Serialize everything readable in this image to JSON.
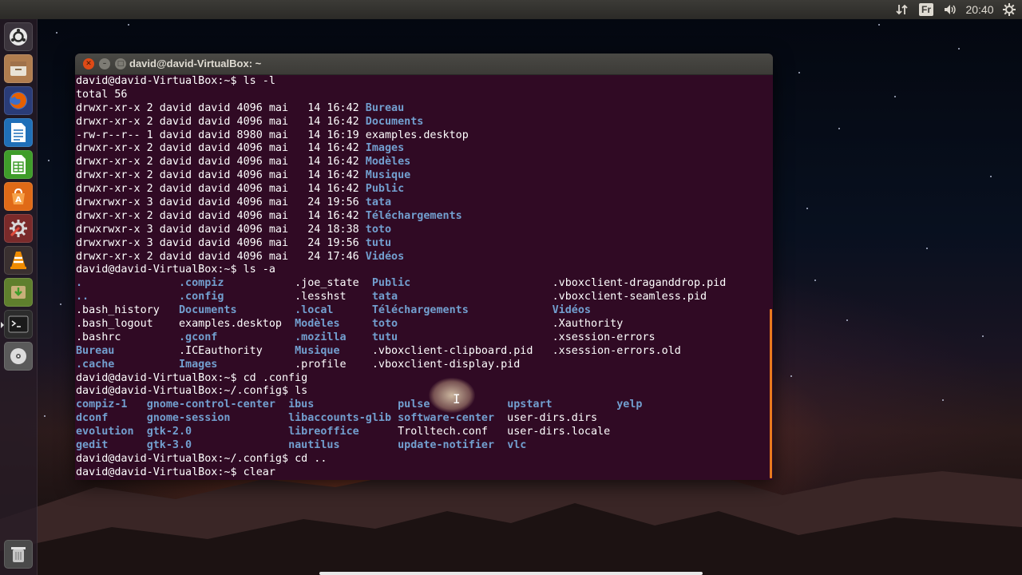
{
  "top_panel": {
    "keyboard_layout": "Fr",
    "clock": "20:40",
    "icons": [
      "network-arrows-icon",
      "keyboard-layout-icon",
      "volume-icon",
      "gear-icon"
    ]
  },
  "launcher": {
    "items": [
      {
        "name": "ubuntu-dash-icon",
        "color": "#1c5aa8"
      },
      {
        "name": "files-icon",
        "color": "#8a6d4a"
      },
      {
        "name": "firefox-icon",
        "color": "#e66000"
      },
      {
        "name": "libreoffice-writer-icon",
        "color": "#1f6fb8"
      },
      {
        "name": "libreoffice-calc-icon",
        "color": "#3f9d2a"
      },
      {
        "name": "software-center-icon",
        "color": "#e06a17"
      },
      {
        "name": "system-settings-icon",
        "color": "#b8403a"
      },
      {
        "name": "vlc-icon",
        "color": "#f08c00"
      },
      {
        "name": "archive-installer-icon",
        "color": "#7fb03d"
      },
      {
        "name": "terminal-icon",
        "color": "#3a3a3a"
      },
      {
        "name": "dvd-icon",
        "color": "#c8c8c8"
      },
      {
        "name": "trash-icon",
        "color": "#8a8a8a"
      }
    ]
  },
  "window": {
    "title": "david@david-VirtualBox: ~",
    "background": "#300a24",
    "dir_color": "#729fcf",
    "lines": [
      [
        {
          "t": "david@david-VirtualBox:~$ ls -l"
        }
      ],
      [
        {
          "t": "total 56"
        }
      ],
      [
        {
          "t": "drwxr-xr-x 2 david david 4096 mai   14 16:42 "
        },
        {
          "t": "Bureau",
          "d": true
        }
      ],
      [
        {
          "t": "drwxr-xr-x 2 david david 4096 mai   14 16:42 "
        },
        {
          "t": "Documents",
          "d": true
        }
      ],
      [
        {
          "t": "-rw-r--r-- 1 david david 8980 mai   14 16:19 examples.desktop"
        }
      ],
      [
        {
          "t": "drwxr-xr-x 2 david david 4096 mai   14 16:42 "
        },
        {
          "t": "Images",
          "d": true
        }
      ],
      [
        {
          "t": "drwxr-xr-x 2 david david 4096 mai   14 16:42 "
        },
        {
          "t": "Modèles",
          "d": true
        }
      ],
      [
        {
          "t": "drwxr-xr-x 2 david david 4096 mai   14 16:42 "
        },
        {
          "t": "Musique",
          "d": true
        }
      ],
      [
        {
          "t": "drwxr-xr-x 2 david david 4096 mai   14 16:42 "
        },
        {
          "t": "Public",
          "d": true
        }
      ],
      [
        {
          "t": "drwxrwxr-x 3 david david 4096 mai   24 19:56 "
        },
        {
          "t": "tata",
          "d": true
        }
      ],
      [
        {
          "t": "drwxr-xr-x 2 david david 4096 mai   14 16:42 "
        },
        {
          "t": "Téléchargements",
          "d": true
        }
      ],
      [
        {
          "t": "drwxrwxr-x 3 david david 4096 mai   24 18:38 "
        },
        {
          "t": "toto",
          "d": true
        }
      ],
      [
        {
          "t": "drwxrwxr-x 3 david david 4096 mai   24 19:56 "
        },
        {
          "t": "tutu",
          "d": true
        }
      ],
      [
        {
          "t": "drwxr-xr-x 2 david david 4096 mai   24 17:46 "
        },
        {
          "t": "Vidéos",
          "d": true
        }
      ],
      [
        {
          "t": "david@david-VirtualBox:~$ ls -a"
        }
      ],
      [
        {
          "t": ".",
          "d": true
        },
        {
          "t": "               "
        },
        {
          "t": ".compiz",
          "d": true
        },
        {
          "t": "           .joe_state  "
        },
        {
          "t": "Public",
          "d": true
        },
        {
          "t": "                      .vboxclient-draganddrop.pid"
        }
      ],
      [
        {
          "t": "..",
          "d": true
        },
        {
          "t": "              "
        },
        {
          "t": ".config",
          "d": true
        },
        {
          "t": "           .lesshst    "
        },
        {
          "t": "tata",
          "d": true
        },
        {
          "t": "                        .vboxclient-seamless.pid"
        }
      ],
      [
        {
          "t": ".bash_history   "
        },
        {
          "t": "Documents",
          "d": true
        },
        {
          "t": "         "
        },
        {
          "t": ".local",
          "d": true
        },
        {
          "t": "      "
        },
        {
          "t": "Téléchargements",
          "d": true
        },
        {
          "t": "             "
        },
        {
          "t": "Vidéos",
          "d": true
        }
      ],
      [
        {
          "t": ".bash_logout    examples.desktop  "
        },
        {
          "t": "Modèles",
          "d": true
        },
        {
          "t": "     "
        },
        {
          "t": "toto",
          "d": true
        },
        {
          "t": "                        .Xauthority"
        }
      ],
      [
        {
          "t": ".bashrc         "
        },
        {
          "t": ".gconf",
          "d": true
        },
        {
          "t": "            "
        },
        {
          "t": ".mozilla",
          "d": true
        },
        {
          "t": "    "
        },
        {
          "t": "tutu",
          "d": true
        },
        {
          "t": "                        .xsession-errors"
        }
      ],
      [
        {
          "t": "Bureau",
          "d": true
        },
        {
          "t": "          .ICEauthority     "
        },
        {
          "t": "Musique",
          "d": true
        },
        {
          "t": "     .vboxclient-clipboard.pid   .xsession-errors.old"
        }
      ],
      [
        {
          "t": ".cache",
          "d": true
        },
        {
          "t": "          "
        },
        {
          "t": "Images",
          "d": true
        },
        {
          "t": "            .profile    .vboxclient-display.pid"
        }
      ],
      [
        {
          "t": "david@david-VirtualBox:~$ cd .config"
        }
      ],
      [
        {
          "t": "david@david-VirtualBox:~/.config$ ls"
        }
      ],
      [
        {
          "t": "compiz-1",
          "d": true
        },
        {
          "t": "   "
        },
        {
          "t": "gnome-control-center",
          "d": true
        },
        {
          "t": "  "
        },
        {
          "t": "ibus",
          "d": true
        },
        {
          "t": "             "
        },
        {
          "t": "pulse",
          "d": true
        },
        {
          "t": "            "
        },
        {
          "t": "upstart",
          "d": true
        },
        {
          "t": "          "
        },
        {
          "t": "yelp",
          "d": true
        }
      ],
      [
        {
          "t": "dconf",
          "d": true
        },
        {
          "t": "      "
        },
        {
          "t": "gnome-session",
          "d": true
        },
        {
          "t": "         "
        },
        {
          "t": "libaccounts-glib",
          "d": true
        },
        {
          "t": " "
        },
        {
          "t": "software-center",
          "d": true
        },
        {
          "t": "  user-dirs.dirs"
        }
      ],
      [
        {
          "t": "evolution",
          "d": true
        },
        {
          "t": "  "
        },
        {
          "t": "gtk-2.0",
          "d": true
        },
        {
          "t": "               "
        },
        {
          "t": "libreoffice",
          "d": true
        },
        {
          "t": "      Trolltech.conf   user-dirs.locale"
        }
      ],
      [
        {
          "t": "gedit",
          "d": true
        },
        {
          "t": "      "
        },
        {
          "t": "gtk-3.0",
          "d": true
        },
        {
          "t": "               "
        },
        {
          "t": "nautilus",
          "d": true
        },
        {
          "t": "         "
        },
        {
          "t": "update-notifier",
          "d": true
        },
        {
          "t": "  "
        },
        {
          "t": "vlc",
          "d": true
        }
      ],
      [
        {
          "t": "david@david-VirtualBox:~/.config$ cd .."
        }
      ],
      [
        {
          "t": "david@david-VirtualBox:~$ clear"
        }
      ]
    ]
  }
}
